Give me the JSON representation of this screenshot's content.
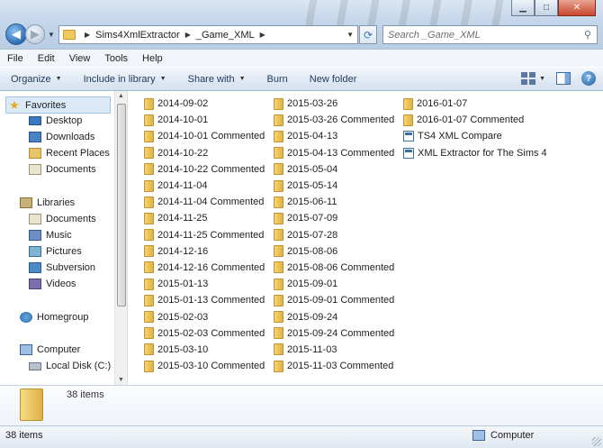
{
  "window": {
    "controls": [
      "minimize",
      "maximize",
      "close"
    ]
  },
  "address": {
    "crumbs": [
      "Sims4XmlExtractor",
      "_Game_XML"
    ]
  },
  "search": {
    "placeholder": "Search _Game_XML"
  },
  "menubar": [
    "File",
    "Edit",
    "View",
    "Tools",
    "Help"
  ],
  "toolbar": {
    "organize": "Organize",
    "include": "Include in library",
    "share": "Share with",
    "burn": "Burn",
    "new_folder": "New folder"
  },
  "nav": {
    "favorites": "Favorites",
    "desktop": "Desktop",
    "downloads": "Downloads",
    "recent": "Recent Places",
    "documents_fav": "Documents",
    "libraries": "Libraries",
    "documents": "Documents",
    "music": "Music",
    "pictures": "Pictures",
    "subversion": "Subversion",
    "videos": "Videos",
    "homegroup": "Homegroup",
    "computer": "Computer",
    "local_disk": "Local Disk (C:)"
  },
  "files": {
    "col1": [
      "2014-09-02",
      "2014-10-01",
      "2014-10-01 Commented",
      "2014-10-22",
      "2014-10-22 Commented",
      "2014-11-04",
      "2014-11-04 Commented",
      "2014-11-25",
      "2014-11-25 Commented",
      "2014-12-16",
      "2014-12-16 Commented",
      "2015-01-13",
      "2015-01-13 Commented",
      "2015-02-03",
      "2015-02-03 Commented",
      "2015-03-10",
      "2015-03-10 Commented"
    ],
    "col2": [
      "2015-03-26",
      "2015-03-26 Commented",
      "2015-04-13",
      "2015-04-13 Commented",
      "2015-05-04",
      "2015-05-14",
      "2015-06-11",
      "2015-07-09",
      "2015-07-28",
      "2015-08-06",
      "2015-08-06 Commented",
      "2015-09-01",
      "2015-09-01 Commented",
      "2015-09-24",
      "2015-09-24 Commented",
      "2015-11-03",
      "2015-11-03 Commented"
    ],
    "col3_folders": [
      "2016-01-07",
      "2016-01-07 Commented"
    ],
    "col3_files": [
      "TS4 XML Compare",
      "XML Extractor for The Sims 4"
    ]
  },
  "details": {
    "count": "38 items"
  },
  "status": {
    "count": "38 items",
    "location": "Computer"
  }
}
